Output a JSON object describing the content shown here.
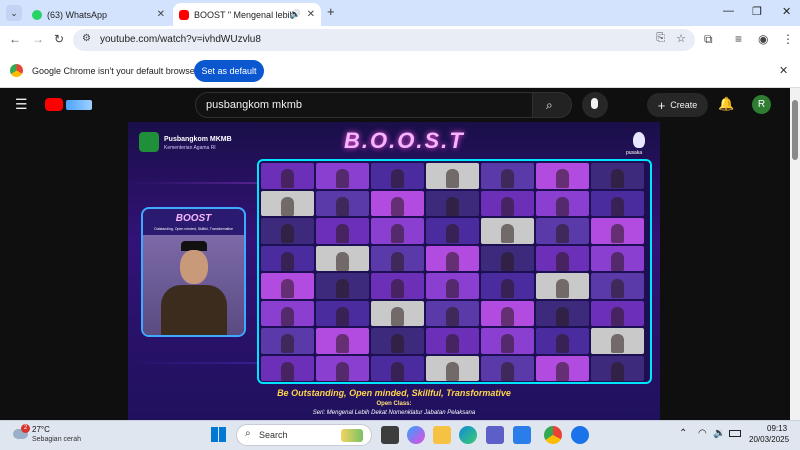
{
  "browser": {
    "tabs": [
      {
        "title": "(63) WhatsApp",
        "favicon": "whatsapp-icon"
      },
      {
        "title": "BOOST \" Mengenal lebih d",
        "favicon": "youtube-icon"
      }
    ],
    "url": "youtube.com/watch?v=ivhdWUzvlu8",
    "infobar_text": "Google Chrome isn't your default browser",
    "set_default_label": "Set as default"
  },
  "youtube": {
    "search_value": "pusbangkom mkmb",
    "create_label": "Create",
    "avatar_letter": "R"
  },
  "video": {
    "org_name": "Pusbangkom MKMB",
    "org_sub": "Kementerian Agama RI",
    "banner_title": "B.O.O.S.T",
    "right_logo": "pusaka",
    "speaker_title": "BOOST",
    "speaker_sub": "Outstanding, Open minded, Skillful, Transformative",
    "tagline": "Be Outstanding, Open minded, Skillful, Transformative",
    "open_class": "Open Class:",
    "series": "Seri: Mengenal Lebih Dekat Nomenklatur Jabatan Pelaksana"
  },
  "taskbar": {
    "temperature": "27°C",
    "weather": "Sebagian cerah",
    "weather_badge": "2",
    "search_placeholder": "Search",
    "time": "09:13",
    "date": "20/03/2025"
  },
  "colors": {
    "tab_strip": "#d3e3fd",
    "accent_blue": "#0b57d0",
    "youtube_bg": "#0f0f0f",
    "video_purple": "#321277",
    "grid_border": "#00e5ff"
  }
}
